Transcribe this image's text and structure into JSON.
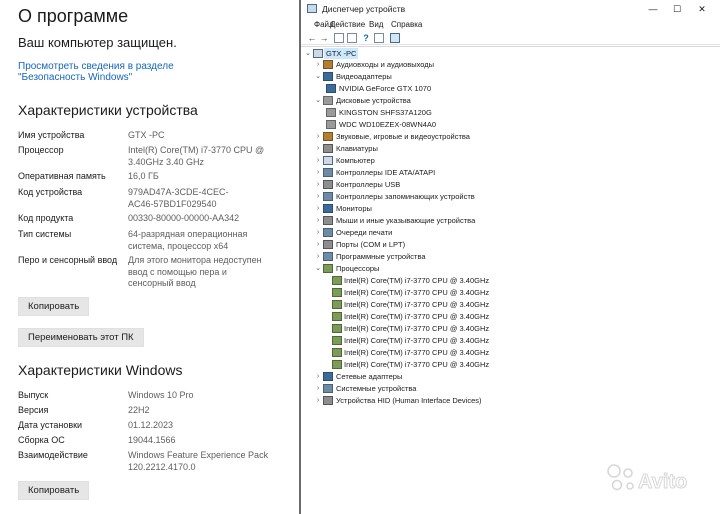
{
  "about": {
    "title": "О программе",
    "protected": "Ваш компьютер защищен.",
    "security_link_line1": "Просмотреть сведения в разделе",
    "security_link_line2": "\"Безопасность Windows\"",
    "device_section_title": "Характеристики устройства",
    "device_specs": [
      {
        "key": "Имя устройства",
        "value": "GTX -PC"
      },
      {
        "key": "Процессор",
        "value": "Intel(R) Core(TM) i7-3770 CPU @\n3.40GHz   3.40 GHz"
      },
      {
        "key": "Оперативная память",
        "value": "16,0 ГБ"
      },
      {
        "key": "Код устройства",
        "value": "979AD47A-3CDE-4CEC-\nAC46-57BD1F029540"
      },
      {
        "key": "Код продукта",
        "value": "00330-80000-00000-AA342"
      },
      {
        "key": "Тип системы",
        "value": "64-разрядная операционная\nсистема, процессор x64"
      },
      {
        "key": "Перо и сенсорный ввод",
        "value": "Для этого монитора недоступен\nввод с помощью пера и\nсенсорный ввод"
      }
    ],
    "copy_button": "Копировать",
    "rename_button": "Переименовать этот ПК",
    "windows_section_title": "Характеристики Windows",
    "windows_specs": [
      {
        "key": "Выпуск",
        "value": "Windows 10 Pro"
      },
      {
        "key": "Версия",
        "value": "22H2"
      },
      {
        "key": "Дата установки",
        "value": "01.12.2023"
      },
      {
        "key": "Сборка ОС",
        "value": "19044.1566"
      },
      {
        "key": "Взаимодействие",
        "value": "Windows Feature Experience Pack\n120.2212.4170.0"
      }
    ],
    "copy_button_2": "Копировать"
  },
  "devmgr": {
    "title": "Диспетчер устройств",
    "window_buttons": {
      "minimize": "—",
      "maximize": "☐",
      "close": "✕"
    },
    "menu": [
      "Файл",
      "Действие",
      "Вид",
      "Справка"
    ],
    "root": "GTX -PC",
    "categories": {
      "audio": "Аудиовходы и аудиовыходы",
      "video": "Видеоадаптеры",
      "gpu": "NVIDIA GeForce GTX 1070",
      "disks": "Дисковые устройства",
      "disk1": "KINGSTON SHFS37A120G",
      "disk2": "WDC WD10EZEX-08WN4A0",
      "sound": "Звуковые, игровые и видеоустройства",
      "keyboards": "Клавиатуры",
      "computer": "Компьютер",
      "ide": "Контроллеры IDE ATA/ATAPI",
      "usb": "Контроллеры USB",
      "storage": "Контроллеры запоминающих устройств",
      "monitors": "Мониторы",
      "mice": "Мыши и иные указывающие устройства",
      "print": "Очереди печати",
      "ports": "Порты (COM и LPT)",
      "software": "Программные устройства",
      "cpus": "Процессоры",
      "cpu_item": "Intel(R) Core(TM) i7-3770 CPU @ 3.40GHz",
      "net": "Сетевые адаптеры",
      "system": "Системные устройства",
      "hid": "Устройства HID (Human Interface Devices)"
    }
  },
  "watermark": "Avito"
}
